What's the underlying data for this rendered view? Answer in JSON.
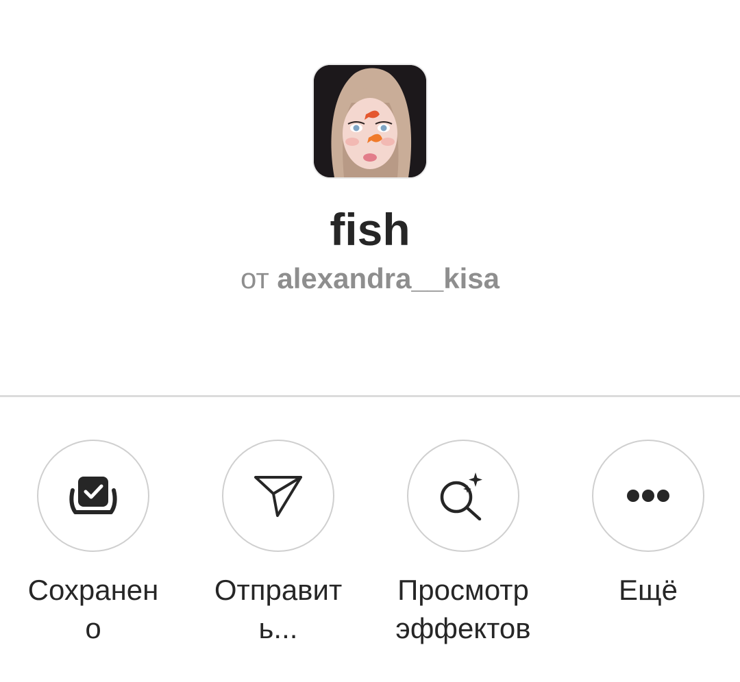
{
  "effect": {
    "title": "fish",
    "author_prefix": "от",
    "author_name": "alexandra__kisa",
    "thumbnail_icon": "effect-preview-image"
  },
  "actions": [
    {
      "label": "Сохранен\nо",
      "icon": "saved-check-icon"
    },
    {
      "label": "Отправит\nь...",
      "icon": "send-paper-plane-icon"
    },
    {
      "label": "Просмотр\nэффектов",
      "icon": "browse-effects-search-sparkle-icon"
    },
    {
      "label": "Ещё",
      "icon": "more-dots-icon"
    }
  ],
  "colors": {
    "text_primary": "#262626",
    "text_secondary": "#8e8e8e",
    "divider": "#dbdbdb",
    "circle_border": "#cfcfcf"
  }
}
